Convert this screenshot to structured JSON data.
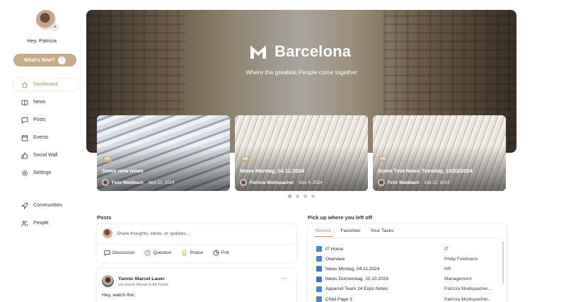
{
  "sidebar": {
    "greeting": "Hey, Patricia",
    "whats_new": {
      "label": "What's New?",
      "count": "7"
    },
    "nav": [
      {
        "label": "Dashboard",
        "icon": "home-icon",
        "active": true
      },
      {
        "label": "News",
        "icon": "book-icon"
      },
      {
        "label": "Posts",
        "icon": "chat-icon"
      },
      {
        "label": "Events",
        "icon": "calendar-icon"
      },
      {
        "label": "Social Wall",
        "icon": "thumbs-up-icon"
      },
      {
        "label": "Settings",
        "icon": "gear-icon"
      },
      {
        "label": "Communities",
        "icon": "rocket-icon"
      },
      {
        "label": "People",
        "icon": "people-icon"
      }
    ]
  },
  "hero": {
    "title": "Barcelona",
    "subtitle": "Where the greatest People come together"
  },
  "news_cards": [
    {
      "tag": "HR",
      "title": "Some new news",
      "author": "Felix Waldbach",
      "date": "Nov 12, 2024"
    },
    {
      "tag": "HR",
      "title": "News Montag, 04.11.2024",
      "author": "Patricia Modispacher",
      "date": "Nov 4, 2024"
    },
    {
      "tag": "HR",
      "title": "Some Test News Tuesday, 10/22/2024",
      "author": "Felix Waldbach",
      "date": "Okt 22, 2024"
    }
  ],
  "posts": {
    "title": "Posts",
    "placeholder": "Share thoughts, ideas, or updates...",
    "actions": [
      "Discussion",
      "Question",
      "Praise",
      "Poll"
    ],
    "first_post": {
      "author": "Yannic Marcel Lauer",
      "meta": "vor einem Monat in All Feeds",
      "text": "Hey, watch this:"
    }
  },
  "pickup": {
    "title": "Pick up where you left off",
    "tabs": [
      "Recent",
      "Favorites",
      "Your Tasks"
    ],
    "rows": [
      {
        "title": "IT Home",
        "owner": "IT",
        "type": "doc"
      },
      {
        "title": "Overview",
        "owner": "Philip Feldmann",
        "type": "doc"
      },
      {
        "title": "News Montag, 04.11.2024",
        "owner": "HR",
        "type": "news"
      },
      {
        "title": "News Donnerstag, 10.10.2024",
        "owner": "Management",
        "type": "news"
      },
      {
        "title": "Appanvil Team 24 Expo Notes",
        "owner": "Patricia Modispacher...",
        "type": "doc"
      },
      {
        "title": "Child Page 3",
        "owner": "Patricia Modispacher...",
        "type": "doc"
      }
    ]
  },
  "colors": {
    "accent": "#c8ad8b",
    "accent_text": "#b38c63"
  }
}
